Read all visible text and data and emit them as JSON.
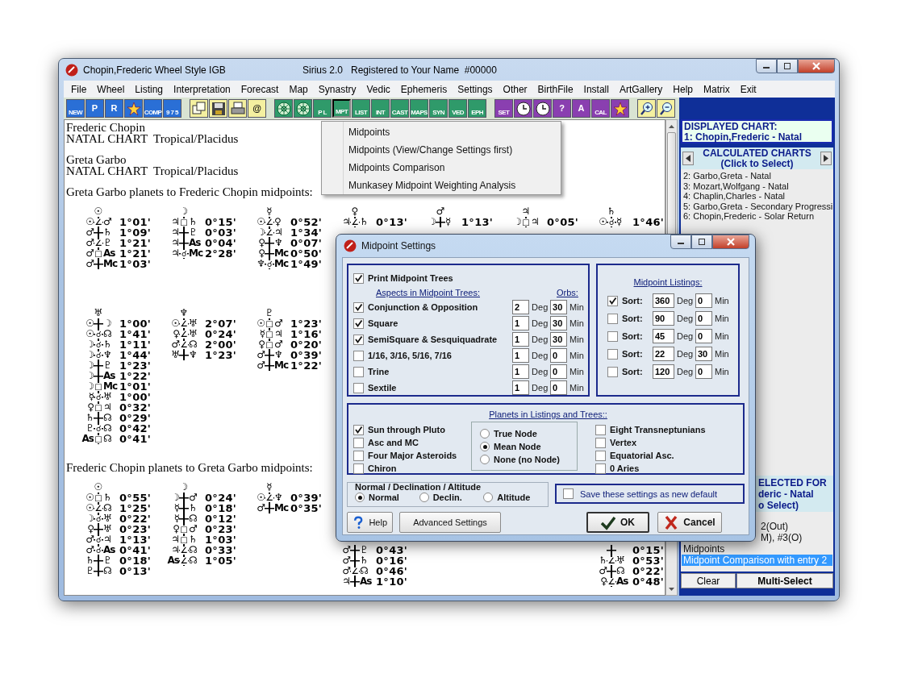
{
  "window": {
    "title": "Chopin,Frederic Wheel Style IGB",
    "subtitle": "Sirius 2.0   Registered to Your Name  #00000"
  },
  "menubar": [
    "File",
    "Wheel",
    "Listing",
    "Interpretation",
    "Forecast",
    "Map",
    "Synastry",
    "Vedic",
    "Ephemeris",
    "Settings",
    "Other",
    "BirthFile",
    "Install",
    "ArtGallery",
    "Help",
    "Matrix",
    "Exit"
  ],
  "toolbar": [
    {
      "kind": "chart",
      "items": [
        {
          "kind": "text",
          "label": "NEW",
          "selected": false
        },
        {
          "kind": "text",
          "label": "P",
          "selected": false
        },
        {
          "kind": "text",
          "label": "R",
          "selected": false
        },
        {
          "kind": "star",
          "selected": false
        },
        {
          "kind": "text",
          "label": "COMP",
          "selected": false
        },
        {
          "kind": "text",
          "label": "9 7 5",
          "selected": false
        }
      ]
    },
    {
      "kind": "file",
      "items": [
        {
          "kind": "copy",
          "selected": false
        },
        {
          "kind": "disk",
          "selected": false
        },
        {
          "kind": "printer",
          "selected": false
        },
        {
          "kind": "text",
          "label": "@",
          "selected": false
        }
      ]
    },
    {
      "kind": "report",
      "items": [
        {
          "kind": "wheel",
          "selected": false
        },
        {
          "kind": "wheel",
          "selected": false
        },
        {
          "kind": "text",
          "label": "P L",
          "selected": false
        },
        {
          "kind": "text",
          "label": "MPT",
          "selected": true
        },
        {
          "kind": "text",
          "label": "LIST",
          "selected": false
        },
        {
          "kind": "text",
          "label": "INT",
          "selected": false
        },
        {
          "kind": "text",
          "label": "CAST",
          "selected": false
        },
        {
          "kind": "text",
          "label": "MAPS",
          "selected": false
        },
        {
          "kind": "text",
          "label": "SYN",
          "selected": false
        },
        {
          "kind": "text",
          "label": "VED",
          "selected": false
        },
        {
          "kind": "text",
          "label": "EPH",
          "selected": false
        }
      ]
    },
    {
      "kind": "utility",
      "items": [
        {
          "kind": "text",
          "label": "SET",
          "selected": false
        },
        {
          "kind": "clock",
          "selected": false
        },
        {
          "kind": "clock",
          "selected": false
        },
        {
          "kind": "text",
          "label": "?",
          "selected": false
        },
        {
          "kind": "text",
          "label": "A",
          "selected": false
        },
        {
          "kind": "text",
          "label": "CAL",
          "selected": false
        },
        {
          "kind": "star",
          "selected": false
        }
      ]
    },
    {
      "kind": "zoom",
      "items": [
        {
          "kind": "zoom-in",
          "selected": false
        },
        {
          "kind": "zoom-out",
          "selected": false
        }
      ]
    }
  ],
  "document": {
    "charts": [
      {
        "name": "Frederic Chopin",
        "type": "NATAL CHART  Tropical/Placidus"
      },
      {
        "name": "Greta Garbo",
        "type": "NATAL CHART  Tropical/Placidus"
      }
    ],
    "sections": [
      {
        "heading": "Greta Garbo planets to Frederic Chopin midpoints:",
        "trees": [
          {
            "kind": "tree",
            "top": "☉",
            "rows": [
              {
                "left": "☉",
                "aspect": "∠",
                "right": "♂",
                "orb": "1°01'"
              },
              {
                "left": "♂",
                "right": "♄",
                "orb": "1°09'"
              },
              {
                "left": "♂",
                "aspect": "∠",
                "right": "♇",
                "orb": "1°21'"
              },
              {
                "left": "♂",
                "aspect": "□",
                "right": "As",
                "orb": "1°21'"
              },
              {
                "left": "♂",
                "right": "Mc",
                "orb": "1°03'"
              }
            ]
          },
          {
            "kind": "tree",
            "top": "☽",
            "rows": [
              {
                "left": "♃",
                "aspect": "□",
                "right": "♄",
                "orb": "0°15'"
              },
              {
                "left": "♃",
                "right": "♇",
                "orb": "0°03'"
              },
              {
                "left": "♃",
                "right": "As",
                "orb": "0°04'"
              },
              {
                "left": "♃",
                "aspect": "☌",
                "right": "Mc",
                "orb": "2°28'"
              }
            ]
          },
          {
            "kind": "tree",
            "top": "☿",
            "rows": [
              {
                "left": "☉",
                "aspect": "∠",
                "right": "♀",
                "orb": "0°52'"
              },
              {
                "left": "☽",
                "aspect": "∠",
                "right": "♃",
                "orb": "1°34'"
              },
              {
                "left": "♀",
                "right": "♆",
                "orb": "0°07'"
              },
              {
                "left": "♀",
                "right": "Mc",
                "orb": "0°50'"
              },
              {
                "left": "♆",
                "aspect": "☌",
                "right": "Mc",
                "orb": "1°49'"
              }
            ]
          },
          {
            "kind": "tree",
            "top": "♀",
            "rows": [
              {
                "left": "♃",
                "aspect": "∠",
                "right": "♄",
                "orb": "0°13'"
              }
            ]
          },
          {
            "kind": "tree",
            "top": "♂",
            "rows": [
              {
                "left": "☽",
                "right": "☿",
                "orb": "1°13'"
              }
            ]
          },
          {
            "kind": "tree",
            "top": "♃",
            "rows": [
              {
                "left": "☽",
                "aspect": "□",
                "right": "♃",
                "orb": "0°05'"
              }
            ]
          },
          {
            "kind": "tree",
            "top": "♄",
            "rows": [
              {
                "left": "☉",
                "aspect": "☌",
                "right": "☿",
                "orb": "1°46'"
              }
            ]
          },
          {
            "kind": "tree",
            "top": "♅",
            "rows": [
              {
                "left": "☉",
                "right": "☽",
                "orb": "1°00'"
              },
              {
                "left": "☉",
                "aspect": "☌",
                "right": "☊",
                "orb": "1°41'"
              },
              {
                "left": "☽",
                "aspect": "☌",
                "right": "♄",
                "orb": "1°11'"
              },
              {
                "left": "☽",
                "aspect": "☌",
                "right": "♆",
                "orb": "1°44'"
              },
              {
                "left": "☽",
                "right": "♇",
                "orb": "1°23'"
              },
              {
                "left": "☽",
                "right": "As",
                "orb": "1°22'"
              },
              {
                "left": "☽",
                "aspect": "□",
                "right": "Mc",
                "orb": "1°01'"
              },
              {
                "left": "☿",
                "aspect": "☌",
                "right": "♅",
                "orb": "1°00'"
              },
              {
                "left": "♀",
                "aspect": "□",
                "right": "♃",
                "orb": "0°32'"
              },
              {
                "left": "♄",
                "right": "☊",
                "orb": "0°29'"
              },
              {
                "left": "♇",
                "aspect": "☌",
                "right": "☊",
                "orb": "0°42'"
              },
              {
                "left": "As",
                "aspect": "□",
                "right": "☊",
                "orb": "0°41'"
              }
            ]
          },
          {
            "kind": "tree",
            "top": "♆",
            "rows": [
              {
                "left": "☉",
                "aspect": "∠",
                "right": "♅",
                "orb": "2°07'"
              },
              {
                "left": "♀",
                "aspect": "∠",
                "right": "♅",
                "orb": "0°24'"
              },
              {
                "left": "♂",
                "aspect": "∠",
                "right": "☊",
                "orb": "2°00'"
              },
              {
                "left": "♅",
                "right": "♆",
                "orb": "1°23'"
              }
            ]
          },
          {
            "kind": "tree",
            "top": "♇",
            "rows": [
              {
                "left": "☉",
                "aspect": "□",
                "right": "♂",
                "orb": "1°23'"
              },
              {
                "left": "☿",
                "aspect": "□",
                "right": "♃",
                "orb": "1°16'"
              },
              {
                "left": "♀",
                "aspect": "□",
                "right": "♂",
                "orb": "0°20'"
              },
              {
                "left": "♂",
                "right": "♆",
                "orb": "0°39'"
              },
              {
                "left": "♂",
                "right": "Mc",
                "orb": "1°22'"
              }
            ]
          }
        ]
      },
      {
        "heading": "Frederic Chopin planets to Greta Garbo midpoints:",
        "trees": [
          {
            "kind": "tree",
            "top": "☉",
            "rows": [
              {
                "left": "☉",
                "aspect": "□",
                "right": "♄",
                "orb": "0°55'"
              },
              {
                "left": "☉",
                "aspect": "∠",
                "right": "☊",
                "orb": "1°25'"
              },
              {
                "left": "☽",
                "aspect": "☌",
                "right": "♅",
                "orb": "0°22'"
              },
              {
                "left": "♀",
                "right": "♅",
                "orb": "0°23'"
              },
              {
                "left": "♂",
                "aspect": "☌",
                "right": "♃",
                "orb": "1°13'"
              },
              {
                "left": "♂",
                "aspect": "☌",
                "right": "As",
                "orb": "0°41'"
              },
              {
                "left": "♄",
                "right": "♇",
                "orb": "0°18'"
              },
              {
                "left": "♇",
                "right": "☊",
                "orb": "0°13'"
              }
            ]
          },
          {
            "kind": "tree",
            "top": "☽",
            "rows": [
              {
                "left": "☽",
                "right": "♂",
                "orb": "0°24'"
              },
              {
                "left": "☿",
                "right": "♄",
                "orb": "0°18'"
              },
              {
                "left": "☿",
                "right": "☊",
                "orb": "0°12'"
              },
              {
                "left": "♀",
                "aspect": "□",
                "right": "♂",
                "orb": "0°23'"
              },
              {
                "left": "♃",
                "aspect": "□",
                "right": "♄",
                "orb": "1°03'"
              },
              {
                "left": "♃",
                "aspect": "∠",
                "right": "☊",
                "orb": "0°33'"
              },
              {
                "left": "As",
                "aspect": "∠",
                "right": "☊",
                "orb": "1°05'"
              }
            ]
          },
          {
            "kind": "tree",
            "top": "☿",
            "rows": [
              {
                "left": "☉",
                "aspect": "∠",
                "right": "♆",
                "orb": "0°39'"
              },
              {
                "left": "♂",
                "right": "Mc",
                "orb": "0°35'"
              }
            ]
          },
          {
            "kind": "tree",
            "rows": [
              {
                "left": "♂",
                "right": "♇",
                "orb": "0°43'"
              },
              {
                "left": "♂",
                "right": "♄",
                "orb": "0°16'"
              },
              {
                "left": "♂",
                "aspect": "∠",
                "right": "☊",
                "orb": "0°46'"
              },
              {
                "left": "♃",
                "right": "As",
                "orb": "1°10'"
              }
            ]
          },
          {
            "kind": "hidden"
          },
          {
            "kind": "hidden"
          },
          {
            "kind": "tree",
            "rows": [
              {
                "orb": "0°15'"
              },
              {
                "left": "♄",
                "aspect": "∠",
                "right": "♅",
                "orb": "0°53'"
              },
              {
                "left": "♂",
                "right": "☊",
                "orb": "0°22'"
              },
              {
                "left": "♀",
                "aspect": "∠",
                "right": "As",
                "orb": "0°48'"
              }
            ]
          }
        ]
      }
    ]
  },
  "side_panel": {
    "displayed": {
      "title": "DISPLAYED CHART:",
      "chart": "1: Chopin,Frederic - Natal"
    },
    "calculated": {
      "title": "CALCULATED CHARTS",
      "hint": "(Click to Select)",
      "items": [
        "2: Garbo,Greta - Natal",
        "3: Mozart,Wolfgang - Natal",
        "4: Chaplin,Charles - Natal",
        "5: Garbo,Greta - Secondary Progressi",
        "6: Chopin,Frederic - Solar Return"
      ]
    },
    "selected_for": [
      "ELECTED FOR",
      "deric - Natal",
      "o Select)"
    ],
    "selected_items": [
      {
        "text": "2(Out)",
        "cut": true,
        "selected": false
      },
      {
        "text": "M), #3(O)",
        "cut": true,
        "selected": false
      },
      {
        "text": "Midpoints",
        "cut": false,
        "selected": false
      },
      {
        "text": "Midpoint Comparison  with entry 2",
        "cut": false,
        "selected": true
      }
    ],
    "buttons": [
      "Clear",
      "Multi-Select"
    ]
  },
  "synastry_menu": [
    "Midpoints",
    "Midpoints (View/Change Settings first)",
    "Midpoints Comparison",
    "Munkasey Midpoint Weighting Analysis"
  ],
  "dialog": {
    "title": "Midpoint Settings",
    "print_trees": {
      "label": "Print Midpoint Trees",
      "checked": true
    },
    "aspects_heading": "Aspects in Midpoint Trees:",
    "orbs_heading": "Orbs:",
    "aspects": [
      {
        "label": "Conjunction & Opposition",
        "checked": true,
        "deg": "2",
        "deg_unit": "Deg",
        "min": "30",
        "min_unit": "Min"
      },
      {
        "label": "Square",
        "checked": true,
        "deg": "1",
        "deg_unit": "Deg",
        "min": "30",
        "min_unit": "Min"
      },
      {
        "label": "SemiSquare & Sesquiquadrate",
        "checked": true,
        "deg": "1",
        "deg_unit": "Deg",
        "min": "30",
        "min_unit": "Min"
      },
      {
        "label": "1/16, 3/16, 5/16, 7/16",
        "checked": false,
        "deg": "1",
        "deg_unit": "Deg",
        "min": "0",
        "min_unit": "Min"
      },
      {
        "label": "Trine",
        "checked": false,
        "deg": "1",
        "deg_unit": "Deg",
        "min": "0",
        "min_unit": "Min"
      },
      {
        "label": "Sextile",
        "checked": false,
        "deg": "1",
        "deg_unit": "Deg",
        "min": "0",
        "min_unit": "Min"
      }
    ],
    "listings_heading": "Midpoint Listings:",
    "listings": [
      {
        "label": "Sort:",
        "checked": true,
        "deg": "360",
        "deg_unit": "Deg",
        "min": "0",
        "min_unit": "Min"
      },
      {
        "label": "Sort:",
        "checked": false,
        "deg": "90",
        "deg_unit": "Deg",
        "min": "0",
        "min_unit": "Min"
      },
      {
        "label": "Sort:",
        "checked": false,
        "deg": "45",
        "deg_unit": "Deg",
        "min": "0",
        "min_unit": "Min"
      },
      {
        "label": "Sort:",
        "checked": false,
        "deg": "22",
        "deg_unit": "Deg",
        "min": "30",
        "min_unit": "Min"
      },
      {
        "label": "Sort:",
        "checked": false,
        "deg": "120",
        "deg_unit": "Deg",
        "min": "0",
        "min_unit": "Min"
      }
    ],
    "planets_heading": "Planets in Listings and Trees::",
    "planets_left": [
      {
        "label": "Sun through Pluto",
        "checked": true
      },
      {
        "label": "Asc and MC",
        "checked": false
      },
      {
        "label": "Four Major Asteroids",
        "checked": false
      },
      {
        "label": "Chiron",
        "checked": false
      }
    ],
    "nodes": [
      {
        "label": "True Node",
        "selected": false
      },
      {
        "label": "Mean Node",
        "selected": true
      },
      {
        "label": "None (no Node)",
        "selected": false
      }
    ],
    "planets_right": [
      {
        "label": "Eight Transneptunians",
        "checked": false
      },
      {
        "label": "Vertex",
        "checked": false
      },
      {
        "label": "Equatorial Asc.",
        "checked": false
      },
      {
        "label": "0 Aries",
        "checked": false
      }
    ],
    "mode_heading": "Normal / Declination / Altitude",
    "modes": [
      {
        "label": "Normal",
        "selected": true
      },
      {
        "label": "Declin.",
        "selected": false
      },
      {
        "label": "Altitude",
        "selected": false
      }
    ],
    "save_default": {
      "label": "Save these settings as new default",
      "checked": false
    },
    "buttons": [
      {
        "kind": "help",
        "label": "Help"
      },
      {
        "kind": "plain",
        "label": "Advanced Settings"
      },
      {
        "kind": "ok",
        "label": "OK"
      },
      {
        "kind": "cancel",
        "label": "Cancel"
      }
    ]
  }
}
